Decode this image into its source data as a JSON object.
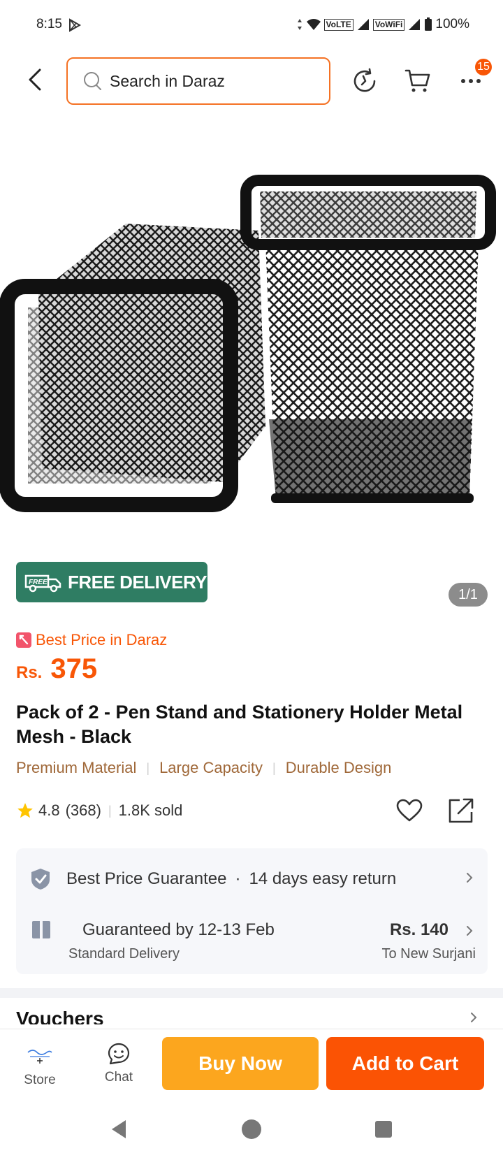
{
  "status_bar": {
    "time": "8:15",
    "network_1": "VoLTE",
    "network_2": "VoWiFi",
    "battery": "100%"
  },
  "header": {
    "search_placeholder": "Search in Daraz",
    "more_badge_count": "15"
  },
  "product": {
    "free_delivery": "FREE DELIVERY",
    "free_badge_small": "FREE",
    "image_counter": "1/1",
    "best_price_label": "Best Price in Daraz",
    "currency": "Rs.",
    "price": "375",
    "title": "Pack of 2 - Pen Stand and Stationery Holder Metal Mesh - Black",
    "features": [
      "Premium Material",
      "Large Capacity",
      "Durable Design"
    ],
    "rating": "4.8",
    "rating_count": "(368)",
    "sold": "1.8K sold"
  },
  "services": {
    "guarantee": "Best Price Guarantee",
    "dot": "·",
    "returns": "14 days easy return",
    "delivery_eta": "Guaranteed by 12-13 Feb",
    "delivery_fee": "Rs. 140",
    "delivery_type": "Standard Delivery",
    "delivery_to": "To New Surjani"
  },
  "sections": {
    "vouchers": "Vouchers"
  },
  "action_bar": {
    "store": "Store",
    "chat": "Chat",
    "buy_now": "Buy Now",
    "add_to_cart": "Add to Cart"
  },
  "colors": {
    "accent": "#f85606",
    "buy_now": "#fca61e",
    "add_to_cart": "#fb5304",
    "free_delivery": "#2f7d63",
    "feature_text": "#a0693a"
  },
  "icons": [
    "play-store-icon",
    "back-arrow-icon",
    "search-icon",
    "history-icon",
    "cart-icon",
    "more-icon",
    "truck-icon",
    "star-icon",
    "heart-icon",
    "share-icon",
    "shield-check-icon",
    "gift-box-icon",
    "chevron-right-icon",
    "chat-icon"
  ]
}
